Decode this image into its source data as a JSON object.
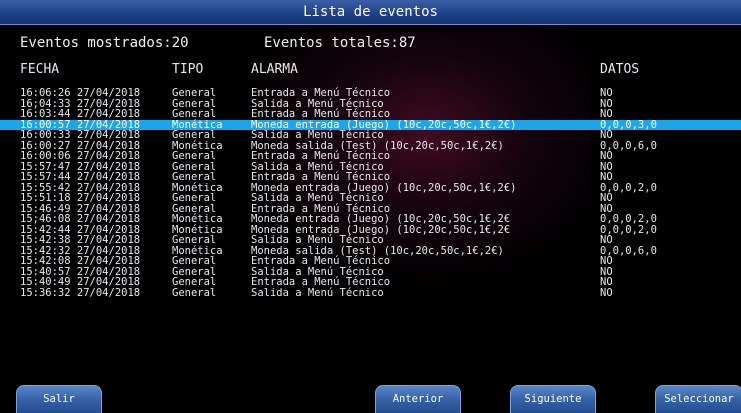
{
  "title": "Lista de eventos",
  "summary": {
    "shown_label": "Eventos mostrados:",
    "shown_value": "20",
    "total_label": "Eventos totales:",
    "total_value": "87"
  },
  "columns": {
    "fecha": "FECHA",
    "tipo": "TIPO",
    "alarma": "ALARMA",
    "datos": "DATOS"
  },
  "rows": [
    {
      "fecha": "16:06:26 27/04/2018",
      "tipo": "General",
      "alarma": "Entrada a Menú Técnico",
      "datos": "NO"
    },
    {
      "fecha": "16;04:33 27/04/2018",
      "tipo": "General",
      "alarma": "Salida a Menú Técnico",
      "datos": "NO"
    },
    {
      "fecha": "16:03:44 27/04/2018",
      "tipo": "General",
      "alarma": "Entrada a Menú Técnico",
      "datos": "NO"
    },
    {
      "fecha": "16:00:57 27/04/2018",
      "tipo": "Monética",
      "alarma": "Moneda entrada (Juego) (10c,20c,50c,1€,2€)",
      "datos": "0,0,0,3,0",
      "selected": true
    },
    {
      "fecha": "16:00:33 27/04/2018",
      "tipo": "General",
      "alarma": "Salida a Menú Técnico",
      "datos": "NO"
    },
    {
      "fecha": "16:00:27 27/04/2018",
      "tipo": "Monética",
      "alarma": "Moneda salida (Test) (10c,20c,50c,1€,2€)",
      "datos": "0,0,0,6,0"
    },
    {
      "fecha": "16:00:06 27/04/2018",
      "tipo": "General",
      "alarma": "Entrada a Menú Técnico",
      "datos": "NO"
    },
    {
      "fecha": "15:57:47 27/04/2018",
      "tipo": "General",
      "alarma": "Salida a Menú Técnico",
      "datos": "NO"
    },
    {
      "fecha": "15:57:44 27/04/2018",
      "tipo": "General",
      "alarma": "Entrada a Menú Técnico",
      "datos": "NO"
    },
    {
      "fecha": "15:55:42 27/04/2018",
      "tipo": "Monética",
      "alarma": "Moneda entrada (Juego) (10c,20c,50c,1€,2€)",
      "datos": "0,0,0,2,0"
    },
    {
      "fecha": "15:51:18 27/04/2018",
      "tipo": "General",
      "alarma": "Salida a Menú Técnico",
      "datos": "NO"
    },
    {
      "fecha": "15:46:49 27/04/2018",
      "tipo": "General",
      "alarma": "Entrada a Menú Técnico",
      "datos": "NO"
    },
    {
      "fecha": "15;46:08 27/04/2018",
      "tipo": "Monética",
      "alarma": "Moneda entrada (Juego) (10c,20c,50c,1€,2€",
      "datos": "0,0,0,2,0"
    },
    {
      "fecha": "15:42:44 27/04/2018",
      "tipo": "Monética",
      "alarma": "Moneda entrada (Juego) (10c,20c,50c,1€,2€",
      "datos": "0,0,0,2,0"
    },
    {
      "fecha": "15:42:38 27/04/2018",
      "tipo": "General",
      "alarma": "Salida a Menú Técnico",
      "datos": "NO"
    },
    {
      "fecha": "15:42:32 27/04/2018",
      "tipo": "Monética",
      "alarma": "Moneda salida (Test) (10c,20c,50c,1€,2€)",
      "datos": "0,0,0,6,0"
    },
    {
      "fecha": "15:42:08 27/04/2018",
      "tipo": "General",
      "alarma": "Entrada a Menú Técnico",
      "datos": "NO"
    },
    {
      "fecha": "15:40:57 27/04/2018",
      "tipo": "General",
      "alarma": "Salida a Menú Técnico",
      "datos": "NO"
    },
    {
      "fecha": "15:40:49 27/04/2018",
      "tipo": "General",
      "alarma": "Entrada a Menú Técnico",
      "datos": "NO"
    },
    {
      "fecha": "15:36:32 27/04/2018",
      "tipo": "General",
      "alarma": "Salida a Menú Técnico",
      "datos": "NO"
    }
  ],
  "buttons": {
    "salir": "Salir",
    "anterior": "Anterior",
    "siguiente": "Siguiente",
    "seleccionar": "Seleccionar"
  },
  "colors": {
    "title_bar": "#1d3f86",
    "selected_row": "#1aa6e8",
    "button": "#3562a8",
    "background": "#000000"
  }
}
